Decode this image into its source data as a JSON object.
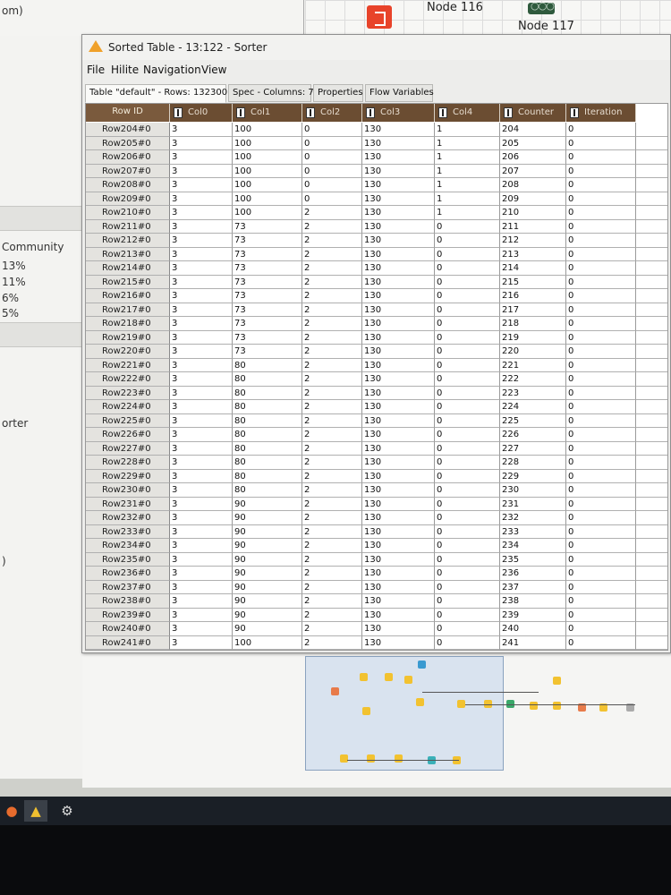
{
  "background": {
    "top_left_text": "om)",
    "node_labels": [
      "Node 116",
      "Node 117"
    ],
    "left_panel": {
      "section_title": "Community",
      "percents": [
        "13%",
        "11%",
        "6%",
        "5%"
      ],
      "item_text": "orter",
      "paren_text": ")"
    },
    "taskbar": {
      "icons": [
        "firefox-icon",
        "knime-icon",
        "settings-icon"
      ]
    }
  },
  "window": {
    "title": "Sorted Table - 13:122 - Sorter",
    "menu": [
      "File",
      "Hilite",
      "Navigation",
      "View"
    ],
    "tabs": [
      "Table \"default\" - Rows: 132300",
      "Spec - Columns: 7",
      "Properties",
      "Flow Variables"
    ],
    "table": {
      "row_id_header": "Row ID",
      "columns": [
        "Col0",
        "Col1",
        "Col2",
        "Col3",
        "Col4",
        "Counter",
        "Iteration"
      ],
      "rows": [
        [
          "Row204#0",
          "3",
          "100",
          "0",
          "130",
          "1",
          "204",
          "0"
        ],
        [
          "Row205#0",
          "3",
          "100",
          "0",
          "130",
          "1",
          "205",
          "0"
        ],
        [
          "Row206#0",
          "3",
          "100",
          "0",
          "130",
          "1",
          "206",
          "0"
        ],
        [
          "Row207#0",
          "3",
          "100",
          "0",
          "130",
          "1",
          "207",
          "0"
        ],
        [
          "Row208#0",
          "3",
          "100",
          "0",
          "130",
          "1",
          "208",
          "0"
        ],
        [
          "Row209#0",
          "3",
          "100",
          "0",
          "130",
          "1",
          "209",
          "0"
        ],
        [
          "Row210#0",
          "3",
          "100",
          "2",
          "130",
          "1",
          "210",
          "0"
        ],
        [
          "Row211#0",
          "3",
          "73",
          "2",
          "130",
          "0",
          "211",
          "0"
        ],
        [
          "Row212#0",
          "3",
          "73",
          "2",
          "130",
          "0",
          "212",
          "0"
        ],
        [
          "Row213#0",
          "3",
          "73",
          "2",
          "130",
          "0",
          "213",
          "0"
        ],
        [
          "Row214#0",
          "3",
          "73",
          "2",
          "130",
          "0",
          "214",
          "0"
        ],
        [
          "Row215#0",
          "3",
          "73",
          "2",
          "130",
          "0",
          "215",
          "0"
        ],
        [
          "Row216#0",
          "3",
          "73",
          "2",
          "130",
          "0",
          "216",
          "0"
        ],
        [
          "Row217#0",
          "3",
          "73",
          "2",
          "130",
          "0",
          "217",
          "0"
        ],
        [
          "Row218#0",
          "3",
          "73",
          "2",
          "130",
          "0",
          "218",
          "0"
        ],
        [
          "Row219#0",
          "3",
          "73",
          "2",
          "130",
          "0",
          "219",
          "0"
        ],
        [
          "Row220#0",
          "3",
          "73",
          "2",
          "130",
          "0",
          "220",
          "0"
        ],
        [
          "Row221#0",
          "3",
          "80",
          "2",
          "130",
          "0",
          "221",
          "0"
        ],
        [
          "Row222#0",
          "3",
          "80",
          "2",
          "130",
          "0",
          "222",
          "0"
        ],
        [
          "Row223#0",
          "3",
          "80",
          "2",
          "130",
          "0",
          "223",
          "0"
        ],
        [
          "Row224#0",
          "3",
          "80",
          "2",
          "130",
          "0",
          "224",
          "0"
        ],
        [
          "Row225#0",
          "3",
          "80",
          "2",
          "130",
          "0",
          "225",
          "0"
        ],
        [
          "Row226#0",
          "3",
          "80",
          "2",
          "130",
          "0",
          "226",
          "0"
        ],
        [
          "Row227#0",
          "3",
          "80",
          "2",
          "130",
          "0",
          "227",
          "0"
        ],
        [
          "Row228#0",
          "3",
          "80",
          "2",
          "130",
          "0",
          "228",
          "0"
        ],
        [
          "Row229#0",
          "3",
          "80",
          "2",
          "130",
          "0",
          "229",
          "0"
        ],
        [
          "Row230#0",
          "3",
          "80",
          "2",
          "130",
          "0",
          "230",
          "0"
        ],
        [
          "Row231#0",
          "3",
          "90",
          "2",
          "130",
          "0",
          "231",
          "0"
        ],
        [
          "Row232#0",
          "3",
          "90",
          "2",
          "130",
          "0",
          "232",
          "0"
        ],
        [
          "Row233#0",
          "3",
          "90",
          "2",
          "130",
          "0",
          "233",
          "0"
        ],
        [
          "Row234#0",
          "3",
          "90",
          "2",
          "130",
          "0",
          "234",
          "0"
        ],
        [
          "Row235#0",
          "3",
          "90",
          "2",
          "130",
          "0",
          "235",
          "0"
        ],
        [
          "Row236#0",
          "3",
          "90",
          "2",
          "130",
          "0",
          "236",
          "0"
        ],
        [
          "Row237#0",
          "3",
          "90",
          "2",
          "130",
          "0",
          "237",
          "0"
        ],
        [
          "Row238#0",
          "3",
          "90",
          "2",
          "130",
          "0",
          "238",
          "0"
        ],
        [
          "Row239#0",
          "3",
          "90",
          "2",
          "130",
          "0",
          "239",
          "0"
        ],
        [
          "Row240#0",
          "3",
          "90",
          "2",
          "130",
          "0",
          "240",
          "0"
        ],
        [
          "Row241#0",
          "3",
          "100",
          "2",
          "130",
          "0",
          "241",
          "0"
        ]
      ]
    }
  },
  "colors": {
    "header_bg": "#6b4d32",
    "warning_icon": "#f0a12a",
    "node_red": "#e8432a"
  }
}
